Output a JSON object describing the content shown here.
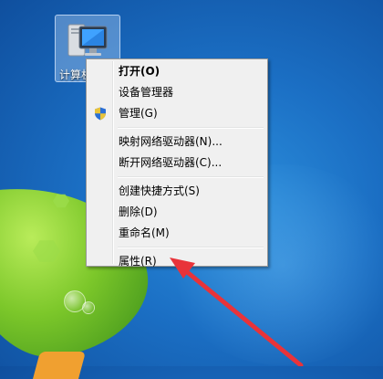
{
  "desktop": {
    "icon_label": "计算机"
  },
  "context_menu": {
    "items": [
      {
        "label": "打开(O)",
        "bold": true
      },
      {
        "label": "设备管理器"
      },
      {
        "label": "管理(G)",
        "icon": "uac-shield-icon"
      },
      {
        "label": "映射网络驱动器(N)..."
      },
      {
        "label": "断开网络驱动器(C)..."
      },
      {
        "label": "创建快捷方式(S)"
      },
      {
        "label": "删除(D)"
      },
      {
        "label": "重命名(M)"
      },
      {
        "label": "属性(R)"
      }
    ]
  },
  "annotation": {
    "arrow_color": "#e8333a",
    "points_to": "属性(R)"
  }
}
